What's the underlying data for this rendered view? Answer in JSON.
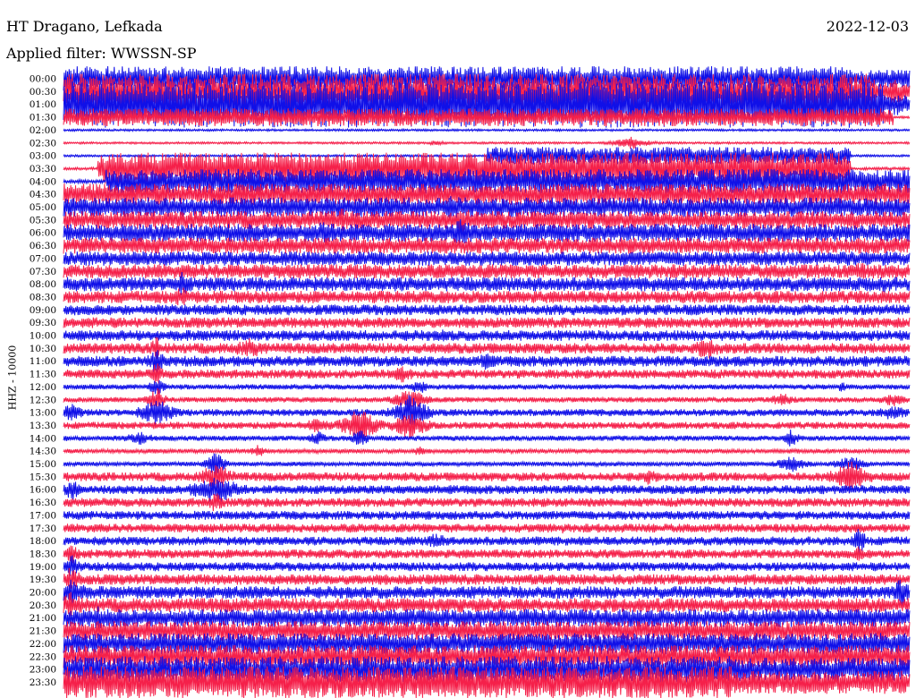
{
  "header": {
    "station": "HT Dragano, Lefkada",
    "date": "2022-12-03",
    "filter": "Applied filter: WWSSN-SP"
  },
  "chart_data": {
    "type": "line",
    "ylabel": "HHZ - 10000",
    "y_tick_labels": [
      "00:00",
      "00:30",
      "01:00",
      "01:30",
      "02:00",
      "02:30",
      "03:00",
      "03:30",
      "04:00",
      "04:30",
      "05:00",
      "05:30",
      "06:00",
      "06:30",
      "07:00",
      "07:30",
      "08:00",
      "08:30",
      "09:00",
      "09:30",
      "10:00",
      "10:30",
      "11:00",
      "11:30",
      "12:00",
      "12:30",
      "13:00",
      "13:30",
      "14:00",
      "14:30",
      "15:00",
      "15:30",
      "16:00",
      "16:30",
      "17:00",
      "17:30",
      "18:00",
      "18:30",
      "19:00",
      "19:30",
      "20:00",
      "20:30",
      "21:00",
      "21:30",
      "22:00",
      "22:30",
      "23:00",
      "23:30"
    ],
    "series_colors": [
      "#1010e8",
      "#f5204a"
    ]
  }
}
